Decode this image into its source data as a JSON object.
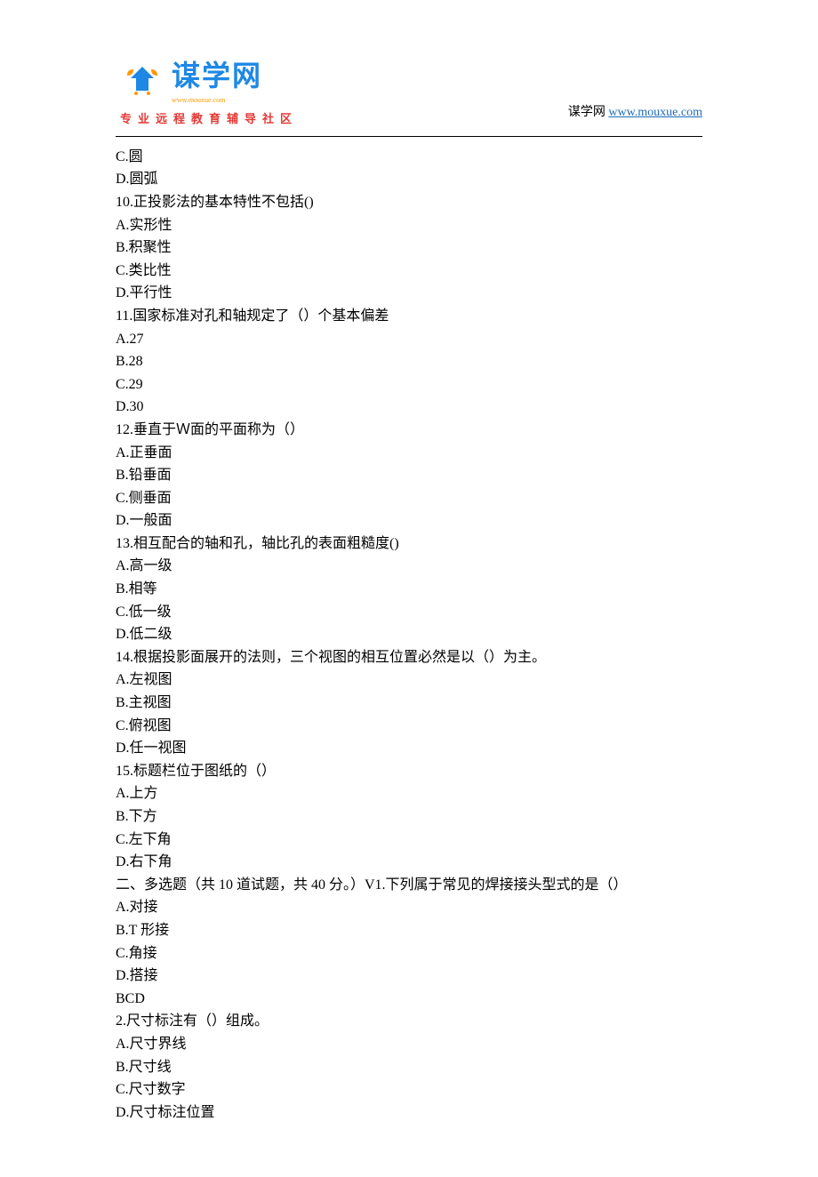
{
  "header": {
    "logo_main": "谋学网",
    "logo_sub": "www.mouxue.com",
    "tagline": "专业远程教育辅导社区",
    "right_label": "谋学网",
    "right_link": "www.mouxue.com"
  },
  "lines": [
    "C.圆",
    "D.圆弧",
    "10.正投影法的基本特性不包括()",
    "A.实形性",
    "B.积聚性",
    "C.类比性",
    "D.平行性",
    "11.国家标准对孔和轴规定了（）个基本偏差",
    "A.27",
    "B.28",
    "C.29",
    "D.30",
    "12.垂直于Ｗ面的平面称为（）",
    "A.正垂面",
    "B.铅垂面",
    "C.侧垂面",
    "D.一般面",
    "13.相互配合的轴和孔，轴比孔的表面粗糙度()",
    "A.高一级",
    "B.相等",
    "C.低一级",
    "D.低二级",
    "14.根据投影面展开的法则，三个视图的相互位置必然是以（）为主。",
    "A.左视图",
    "B.主视图",
    "C.俯视图",
    "D.任一视图",
    "15.标题栏位于图纸的（）",
    "A.上方",
    "B.下方",
    "C.左下角",
    "D.右下角",
    "二、多选题（共 10 道试题，共 40 分。）V1.下列属于常见的焊接接头型式的是（）",
    "A.对接",
    "B.T 形接",
    "C.角接",
    "D.搭接",
    "BCD",
    "2.尺寸标注有（）组成。",
    "A.尺寸界线",
    "B.尺寸线",
    "C.尺寸数字",
    "D.尺寸标注位置"
  ]
}
